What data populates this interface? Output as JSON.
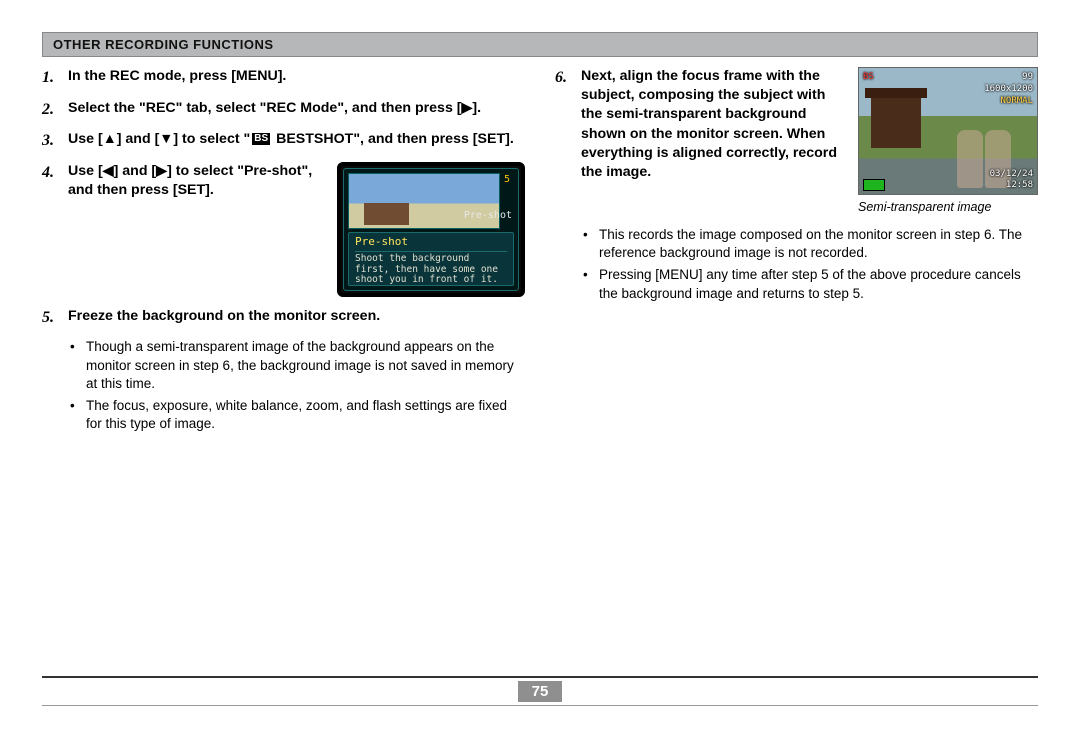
{
  "header": "OTHER RECORDING FUNCTIONS",
  "page_number": "75",
  "left": {
    "s1": "In the REC mode, press [MENU].",
    "s2": "Select the \"REC\" tab, select \"REC Mode\", and then press [▶].",
    "s3_a": "Use [▲] and [▼] to select \"",
    "s3_icon": "BS",
    "s3_b": " BESTSHOT\", and then press [SET].",
    "s4": "Use [◀] and [▶] to select \"Pre-shot\", and then press [SET].",
    "lcd": {
      "count": "5",
      "label": "Pre-shot",
      "btitle": "Pre-shot",
      "btext": "Shoot the background first, then have some one shoot you in front of it."
    },
    "s5": "Freeze the background on the monitor screen.",
    "s5_b1": "Though a semi-transparent image of the background appears on the monitor screen in step 6, the background image is not saved in memory at this time.",
    "s5_b2": "The focus, exposure, white balance, zoom, and flash settings are fixed for this type of image."
  },
  "right": {
    "s6": "Next, align the focus frame with the subject, composing the subject with the semi-transparent background shown on the monitor screen. When everything is aligned correctly, record the image.",
    "cam": {
      "tl": "BS",
      "tr1": "99",
      "tr2": "1600x1200",
      "tr3": "NORMAL",
      "br1": "03/12/24",
      "br2": "12:58"
    },
    "caption": "Semi-transparent image",
    "b1": "This records the image composed on the monitor screen in step 6. The reference background image is not recorded.",
    "b2": "Pressing [MENU] any time after step 5 of the above procedure cancels the background image and returns to step 5."
  }
}
